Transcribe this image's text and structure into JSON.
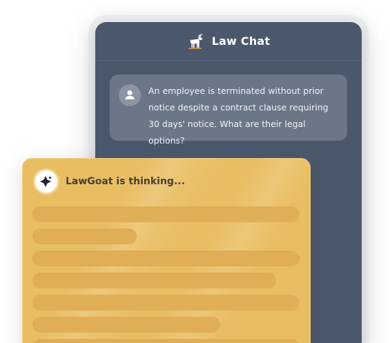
{
  "chat": {
    "title": "Law Chat",
    "header_icon": "goat-icon",
    "user_message": "An employee is terminated without prior notice despite a contract clause requiring 30 days' notice. What are their legal options?",
    "user_avatar_icon": "user-icon"
  },
  "thinking": {
    "label": "LawGoat is thinking...",
    "avatar_icon": "sparkle-icon",
    "skeleton_lines": 7
  },
  "colors": {
    "window_bg": "#4b586c",
    "message_bg": "#6b7687",
    "card_bg": "#e9be63",
    "skeleton": "#dfae55"
  }
}
